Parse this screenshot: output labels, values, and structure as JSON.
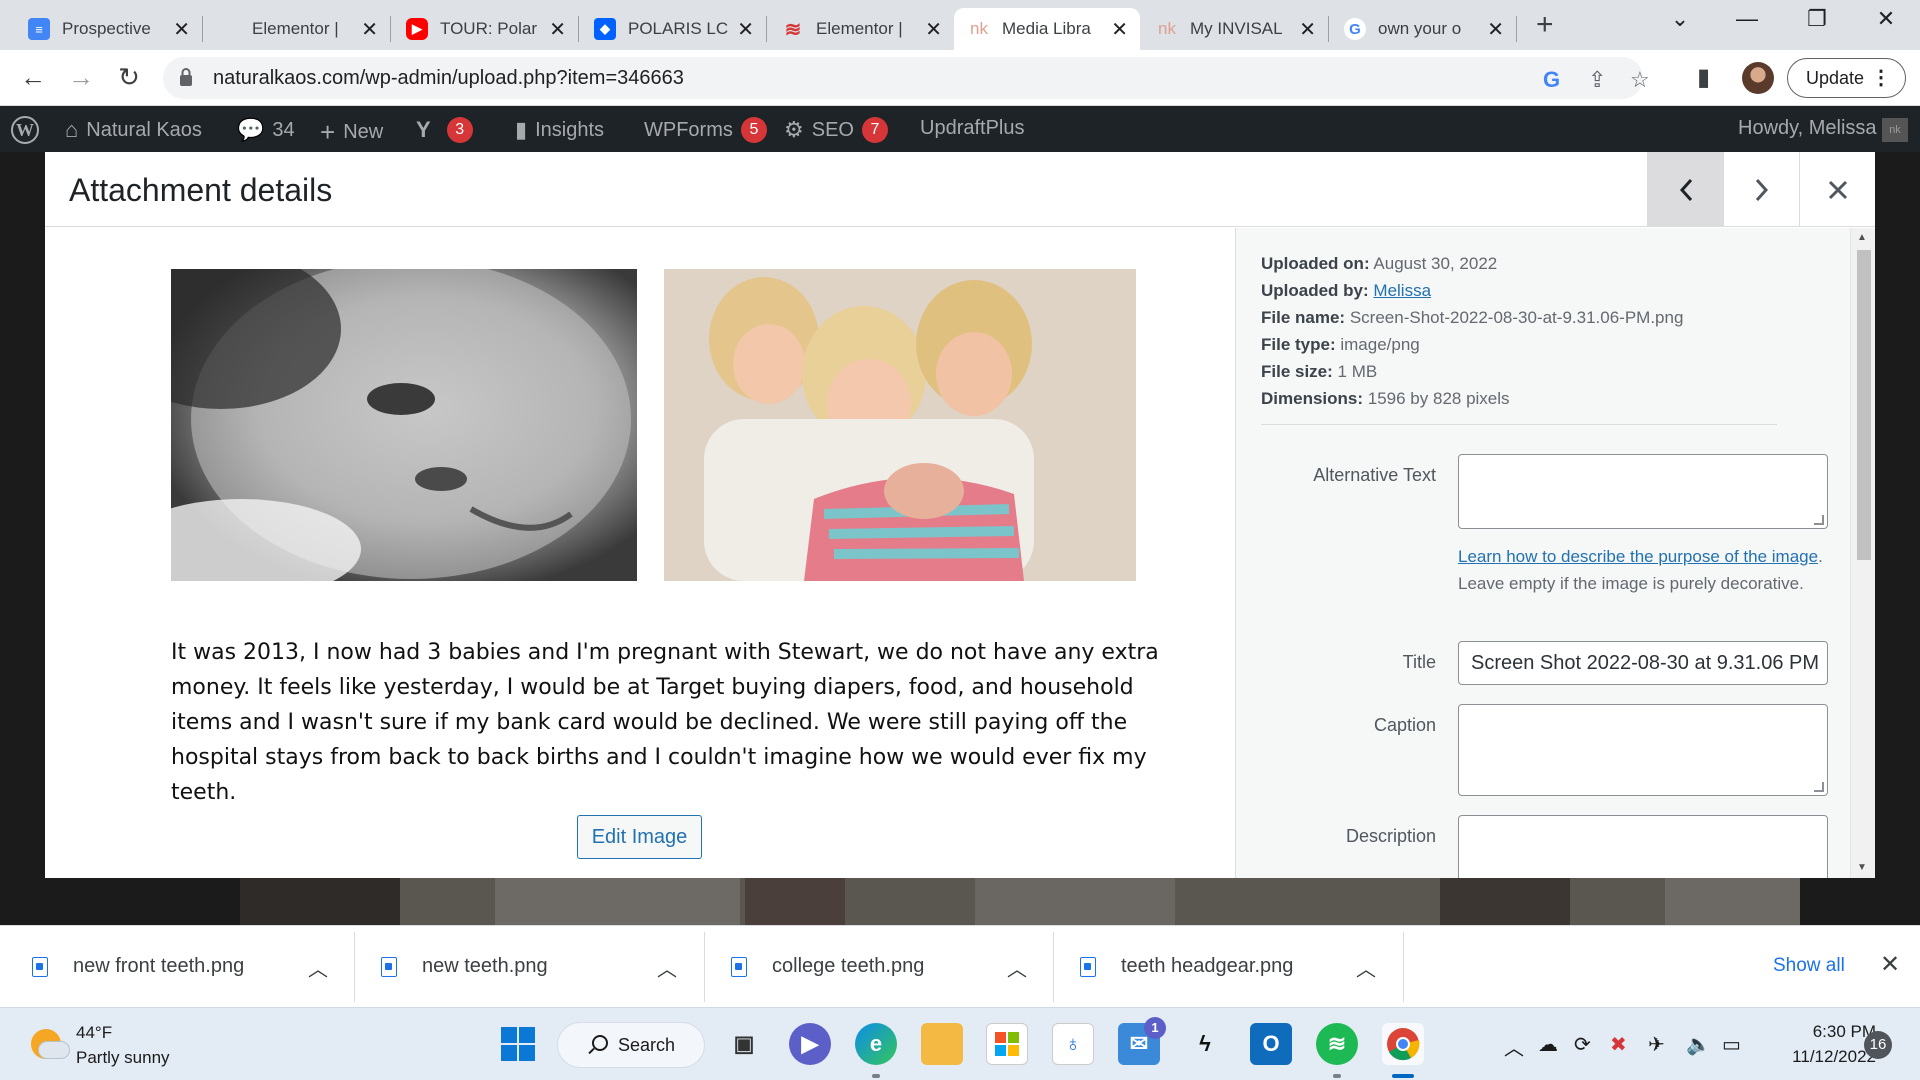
{
  "browser": {
    "tabs": [
      {
        "title": "Prospective",
        "favicon": "docs-icon"
      },
      {
        "title": "Elementor |",
        "favicon": "elementor-icon"
      },
      {
        "title": "TOUR: Polar",
        "favicon": "youtube-icon"
      },
      {
        "title": "POLARIS LC",
        "favicon": "dropbox-icon"
      },
      {
        "title": "Elementor |",
        "favicon": "elementor-red-icon"
      },
      {
        "title": "Media Libra",
        "favicon": "nk-icon",
        "active": true
      },
      {
        "title": "My INVISAL",
        "favicon": "nk-icon"
      },
      {
        "title": "own your o",
        "favicon": "google-icon"
      }
    ],
    "url": "naturalkaos.com/wp-admin/upload.php?item=346663",
    "update_label": "Update"
  },
  "admin_bar": {
    "site_name": "Natural Kaos",
    "comments_count": "34",
    "new_label": "New",
    "yoast_count": "3",
    "insights_label": "Insights",
    "wpforms_label": "WPForms",
    "wpforms_count": "5",
    "seo_label": "SEO",
    "seo_count": "7",
    "updraft_label": "UpdraftPlus",
    "howdy": "Howdy, Melissa",
    "avatar_text": "nk"
  },
  "modal": {
    "title": "Attachment details",
    "caption_paragraph": "It was 2013, I now had 3 babies and I'm pregnant with Stewart, we do not have any extra money. It feels like yesterday, I would be at Target buying diapers, food, and household items and I wasn't sure if my bank card would be declined. We were still paying off the hospital stays from back to back births and I couldn't imagine how we would ever fix my teeth.",
    "edit_image_label": "Edit Image",
    "meta": {
      "uploaded_on_label": "Uploaded on:",
      "uploaded_on": "August 30, 2022",
      "uploaded_by_label": "Uploaded by:",
      "uploaded_by": "Melissa",
      "file_name_label": "File name:",
      "file_name": "Screen-Shot-2022-08-30-at-9.31.06-PM.png",
      "file_type_label": "File type:",
      "file_type": "image/png",
      "file_size_label": "File size:",
      "file_size": "1 MB",
      "dimensions_label": "Dimensions:",
      "dimensions": "1596 by 828 pixels"
    },
    "fields": {
      "alt_label": "Alternative Text",
      "alt_value": "",
      "help_link": "Learn how to describe the purpose of the image",
      "help_rest": ". Leave empty if the image is purely decorative.",
      "title_label": "Title",
      "title_value": "Screen Shot 2022-08-30 at 9.31.06 PM",
      "caption_label": "Caption",
      "caption_value": "",
      "description_label": "Description",
      "description_value": ""
    }
  },
  "downloads": {
    "items": [
      "new front teeth.png",
      "new teeth.png",
      "college teeth.png",
      "teeth headgear.png"
    ],
    "show_all": "Show all"
  },
  "taskbar": {
    "temperature": "44°F",
    "weather": "Partly sunny",
    "search_label": "Search",
    "mail_badge": "1",
    "time": "6:30 PM",
    "date": "11/12/2022",
    "notifications": "16"
  },
  "colors": {
    "wp_blue": "#2271b1",
    "admin_bar": "#1d2327",
    "badge_red": "#d63638",
    "chrome_blue": "#1a73e8"
  }
}
